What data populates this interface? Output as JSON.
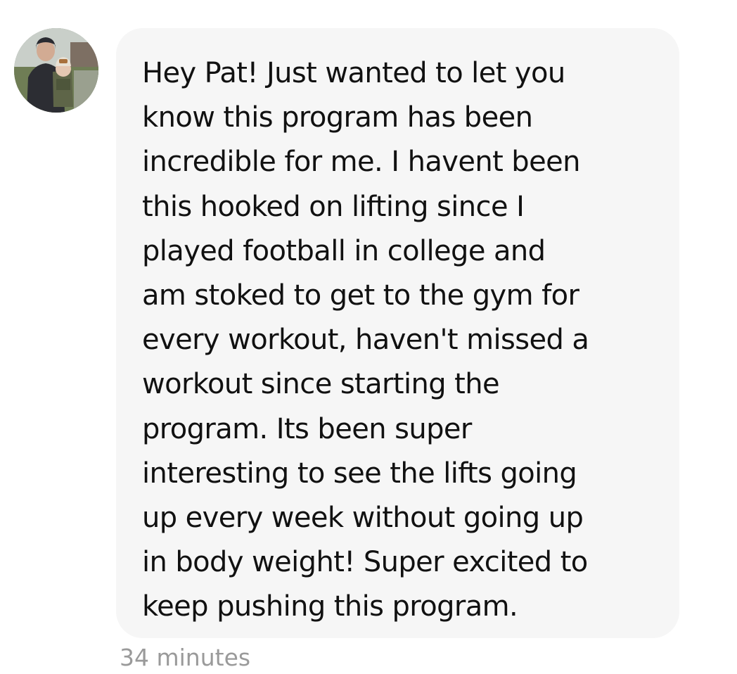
{
  "message": {
    "lines": [
      "Hey Pat! Just wanted to let you",
      "know this program has been",
      "incredible for me. I havent been",
      "this hooked on lifting since I",
      "played football in college and",
      "am stoked to get to the gym for",
      "every workout, haven't missed a",
      "workout since starting the",
      "program. Its been super",
      "interesting to see the lifts going",
      "up every week without going up",
      "in body weight! Super excited to",
      "keep pushing this program."
    ],
    "timestamp": "34 minutes"
  },
  "colors": {
    "bubble_background": "#f6f6f6",
    "message_text": "#111111",
    "timestamp_text": "#9a9a9a"
  }
}
